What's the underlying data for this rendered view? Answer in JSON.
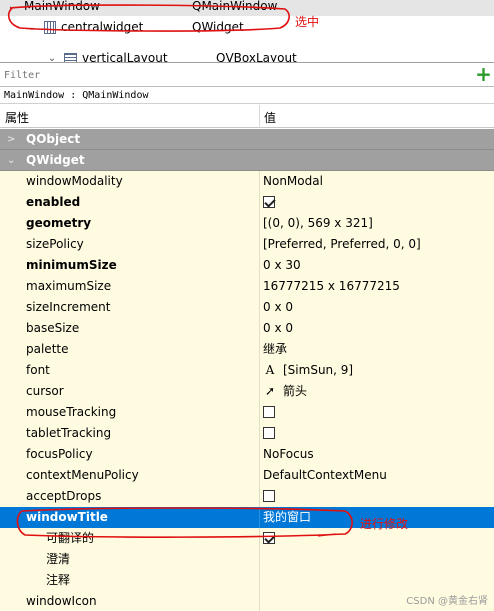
{
  "object_tree": {
    "rows": [
      {
        "name": "MainWindow",
        "class": "QMainWindow"
      },
      {
        "name": "centralwidget",
        "class": "QWidget"
      },
      {
        "name": "verticalLayout",
        "class": "QVBoxLayout"
      }
    ]
  },
  "filter": {
    "placeholder": "Filter"
  },
  "class_label": "MainWindow : QMainWindow",
  "property_header": {
    "property": "属性",
    "value": "值"
  },
  "categories": {
    "qobject": "QObject",
    "qwidget": "QWidget"
  },
  "properties": [
    {
      "name": "windowModality",
      "value": "NonModal"
    },
    {
      "name": "enabled",
      "checked": true
    },
    {
      "name": "geometry",
      "value": "[(0, 0), 569 x 321]"
    },
    {
      "name": "sizePolicy",
      "value": "[Preferred, Preferred, 0, 0]"
    },
    {
      "name": "minimumSize",
      "value": "0 x 30"
    },
    {
      "name": "maximumSize",
      "value": "16777215 x 16777215"
    },
    {
      "name": "sizeIncrement",
      "value": "0 x 0"
    },
    {
      "name": "baseSize",
      "value": "0 x 0"
    },
    {
      "name": "palette",
      "value": "继承"
    },
    {
      "name": "font",
      "icon": "A",
      "value": "[SimSun, 9]"
    },
    {
      "name": "cursor",
      "value": "箭头"
    },
    {
      "name": "mouseTracking",
      "checked": false
    },
    {
      "name": "tabletTracking",
      "checked": false
    },
    {
      "name": "focusPolicy",
      "value": "NoFocus"
    },
    {
      "name": "contextMenuPolicy",
      "value": "DefaultContextMenu"
    },
    {
      "name": "acceptDrops",
      "checked": false
    },
    {
      "name": "windowTitle",
      "value": "我的窗口"
    },
    {
      "name": "可翻译的",
      "checked": true
    },
    {
      "name": "澄清",
      "value": ""
    },
    {
      "name": "注释",
      "value": ""
    },
    {
      "name": "windowIcon",
      "value": ""
    }
  ],
  "annotations": {
    "selected_note": "选中",
    "edit_note": "进行修改",
    "color": "#e01010"
  },
  "watermark": "CSDN @黄金右肾",
  "colors": {
    "selection": "#0078d7",
    "category": "#a0a0a0",
    "property_bg": "#fffbe1",
    "add_icon": "#2a9a2a"
  }
}
